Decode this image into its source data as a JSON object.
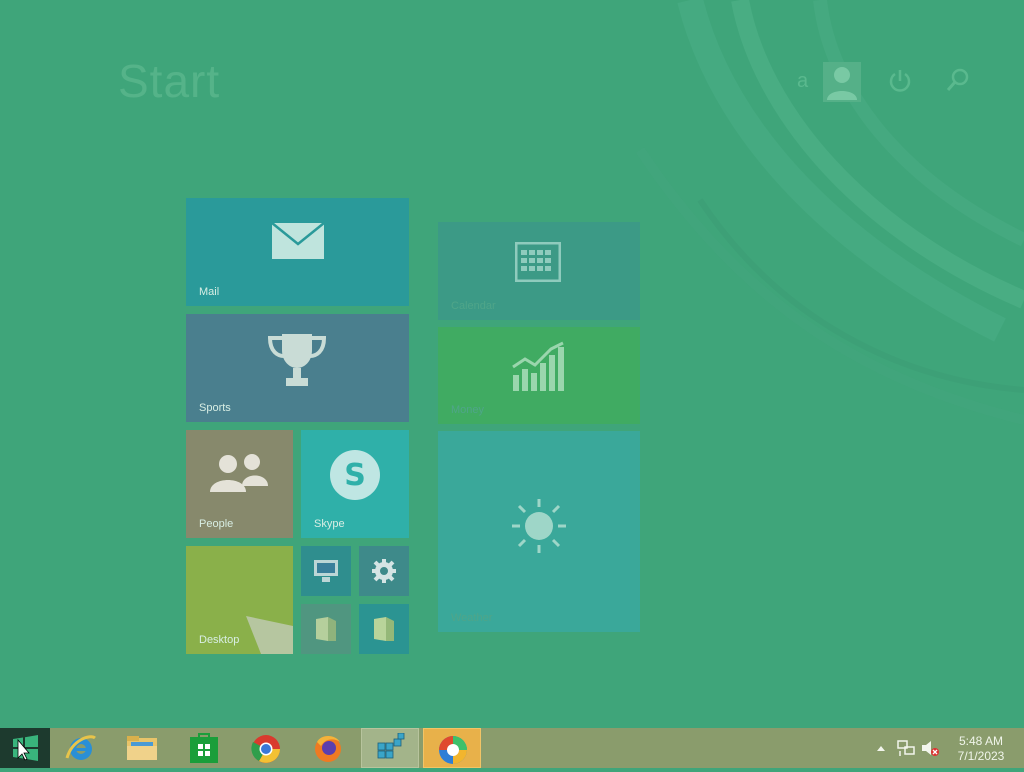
{
  "screen": {
    "title": "Start",
    "user_name": "a",
    "accent_color": "#3fa57a"
  },
  "tiles": {
    "mail": "Mail",
    "sports": "Sports",
    "people": "People",
    "skype": "Skype",
    "desktop": "Desktop",
    "calendar": "Calendar",
    "money": "Money",
    "weather": "Weather"
  },
  "icons": {
    "mail": "envelope-icon",
    "sports": "trophy-icon",
    "people": "people-icon",
    "skype": "skype-icon",
    "calendar": "calendar-icon",
    "money": "chart-icon",
    "weather": "sun-icon",
    "pc": "computer-icon",
    "settings": "gear-icon",
    "files": "folder-icon"
  },
  "taskbar": {
    "apps": [
      "Internet Explorer",
      "File Explorer",
      "Store",
      "Chrome",
      "Firefox",
      "Registry",
      "Edge"
    ],
    "time": "5:48 AM",
    "date": "7/1/2023"
  }
}
